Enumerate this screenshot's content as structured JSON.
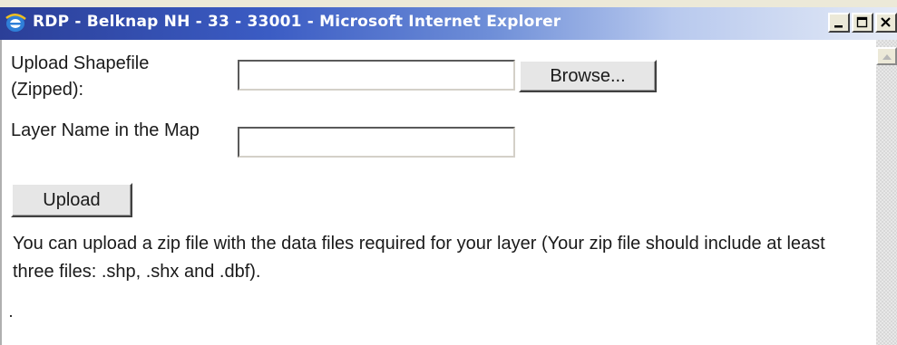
{
  "window": {
    "title": "RDP - Belknap NH - 33 - 33001 - Microsoft Internet Explorer",
    "app_icon": "ie-icon",
    "controls": [
      "minimize-icon",
      "maximize-icon",
      "close-icon"
    ]
  },
  "form": {
    "upload_label": "Upload Shapefile (Zipped):",
    "upload_value": "",
    "browse_label": "Browse...",
    "layer_label": "Layer Name in the Map",
    "layer_value": "",
    "upload_button_label": "Upload",
    "info_text": "You can upload a zip file with the data files required for your layer (Your zip file should include at least three files: .shp, .shx and .dbf)."
  },
  "colors": {
    "titlebar_start": "#2b3f98",
    "titlebar_end": "#e4eaf6",
    "window_background": "#ece9d8"
  }
}
